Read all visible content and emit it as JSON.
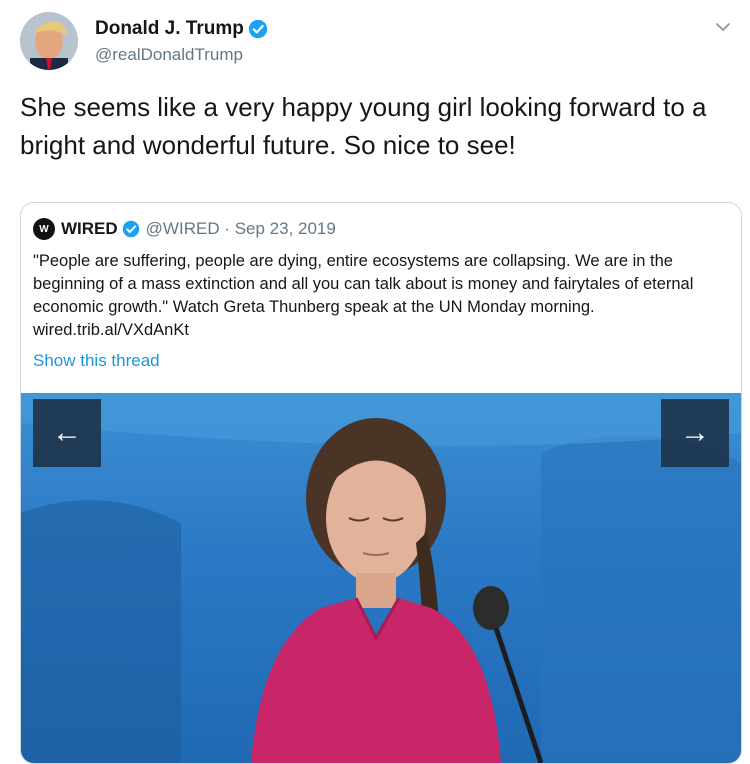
{
  "author": {
    "name": "Donald J. Trump",
    "handle": "@realDonaldTrump"
  },
  "tweet": {
    "text": "She seems like a very happy young girl looking forward to a bright and wonderful future. So nice to see!"
  },
  "quoted_tweet": {
    "name": "WIRED",
    "logo_text": "W",
    "meta": "@WIRED · Sep 23, 2019",
    "text": "\"People are suffering, people are dying, entire ecosystems are collapsing. We are in the beginning of a mass extinction and all you can talk about is money and fairytales of eternal economic growth.\" Watch Greta Thunberg speak at the UN Monday morning. wired.trib.al/VXdAnKt",
    "show_thread": "Show this thread",
    "media": {
      "prev_glyph": "←",
      "next_glyph": "→"
    }
  },
  "colors": {
    "verified": "#1da1f2",
    "link": "#1b95e0",
    "muted": "#657786",
    "border": "#ccd6dd"
  },
  "icons": [
    "verified-badge-icon",
    "chevron-down-icon",
    "arrow-left-icon",
    "arrow-right-icon"
  ]
}
